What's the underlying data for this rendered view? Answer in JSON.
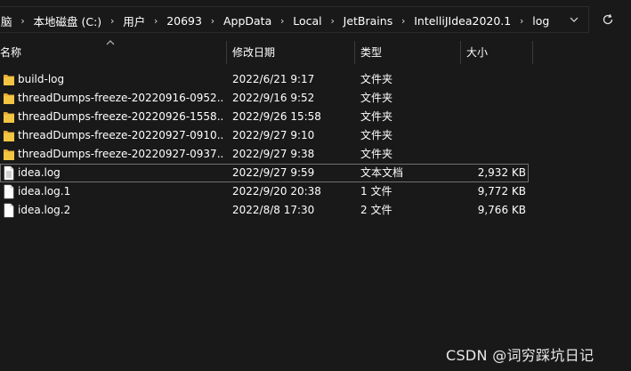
{
  "breadcrumb": {
    "items": [
      "脑",
      "本地磁盘 (C:)",
      "用户",
      "20693",
      "AppData",
      "Local",
      "JetBrains",
      "IntelliJIdea2020.1",
      "log"
    ]
  },
  "columns": {
    "name": "名称",
    "date": "修改日期",
    "type": "类型",
    "size": "大小"
  },
  "files": [
    {
      "name": "build-log",
      "date": "2022/6/21 9:17",
      "type": "文件夹",
      "size": "",
      "kind": "folder-icon"
    },
    {
      "name": "threadDumps-freeze-20220916-0952...",
      "date": "2022/9/16 9:52",
      "type": "文件夹",
      "size": "",
      "kind": "folder-icon"
    },
    {
      "name": "threadDumps-freeze-20220926-1558...",
      "date": "2022/9/26 15:58",
      "type": "文件夹",
      "size": "",
      "kind": "folder-icon"
    },
    {
      "name": "threadDumps-freeze-20220927-0910...",
      "date": "2022/9/27 9:10",
      "type": "文件夹",
      "size": "",
      "kind": "folder-icon"
    },
    {
      "name": "threadDumps-freeze-20220927-0937...",
      "date": "2022/9/27 9:38",
      "type": "文件夹",
      "size": "",
      "kind": "folder-icon"
    },
    {
      "name": "idea.log",
      "date": "2022/9/27 9:59",
      "type": "文本文档",
      "size": "2,932 KB",
      "kind": "text-file-icon",
      "selected": true
    },
    {
      "name": "idea.log.1",
      "date": "2022/9/20 20:38",
      "type": "1 文件",
      "size": "9,772 KB",
      "kind": "file-icon"
    },
    {
      "name": "idea.log.2",
      "date": "2022/8/8 17:30",
      "type": "2 文件",
      "size": "9,766 KB",
      "kind": "file-icon"
    }
  ],
  "watermark": "CSDN @词穷踩坑日记",
  "colors": {
    "background": "#191919",
    "folder": "#f3c542",
    "text": "#ffffff",
    "selection_border": "#707070"
  }
}
